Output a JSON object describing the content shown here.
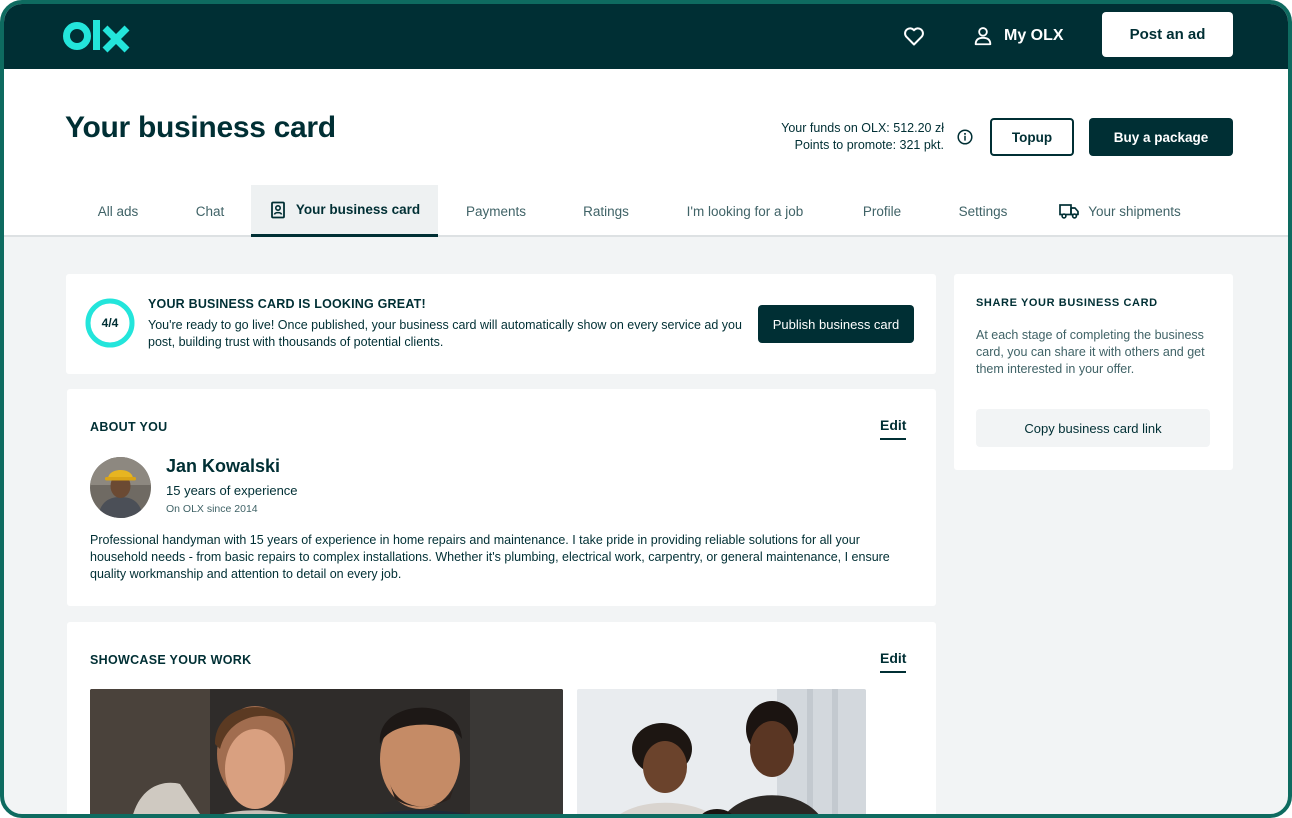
{
  "header": {
    "logo_text": "olx",
    "my_olx": "My OLX",
    "post_ad": "Post an ad"
  },
  "page": {
    "title": "Your business card",
    "funds_line1": "Your funds on OLX: 512.20 zł",
    "funds_line2": "Points to promote: 321 pkt.",
    "topup": "Topup",
    "buy_package": "Buy a package"
  },
  "tabs": [
    {
      "label": "All ads"
    },
    {
      "label": "Chat"
    },
    {
      "label": "Your business card",
      "active": true,
      "icon": "business-card-icon"
    },
    {
      "label": "Payments"
    },
    {
      "label": "Ratings"
    },
    {
      "label": "I'm looking for a job"
    },
    {
      "label": "Profile"
    },
    {
      "label": "Settings"
    },
    {
      "label": "Your shipments",
      "icon": "truck-icon"
    }
  ],
  "status": {
    "progress": "4/4",
    "progress_fraction": 1.0,
    "title": "YOUR BUSINESS CARD IS LOOKING GREAT!",
    "text": "You're ready to go live! Once published, your business card will automatically show on every service ad you post, building trust with thousands of potential clients.",
    "publish": "Publish business card"
  },
  "about": {
    "label": "ABOUT YOU",
    "edit": "Edit",
    "name": "Jan Kowalski",
    "experience": "15 years of experience",
    "since": "On OLX since 2014",
    "bio": "Professional handyman with 15 years of experience in home repairs and maintenance. I take pride in providing reliable solutions for all your household needs - from basic repairs to complex installations. Whether it's plumbing, electrical work, carpentry, or general maintenance, I ensure quality workmanship and attention to detail on every job."
  },
  "share": {
    "label": "SHARE YOUR BUSINESS CARD",
    "text": "At each stage of completing the business card, you can share it with others and get them interested in your offer.",
    "copy": "Copy business card link"
  },
  "showcase": {
    "label": "SHOWCASE YOUR WORK",
    "edit": "Edit"
  },
  "colors": {
    "brand_dark": "#002f34",
    "accent_teal": "#23e5db",
    "frame_border": "#0e6b60"
  }
}
